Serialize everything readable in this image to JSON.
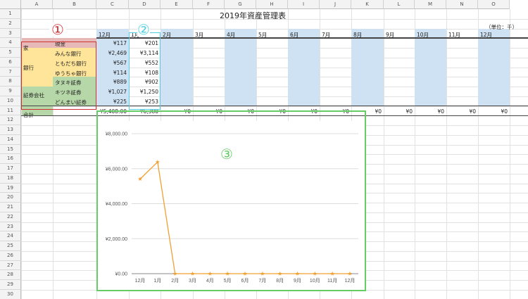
{
  "sheet": {
    "title": "2019年資産管理表",
    "unit_note": "（単位：千）",
    "column_headers": [
      "A",
      "B",
      "C",
      "D",
      "E",
      "F",
      "G",
      "H",
      "I",
      "J",
      "K",
      "L",
      "M",
      "N",
      "O"
    ],
    "row_numbers": [
      "1",
      "2",
      "3",
      "4",
      "5",
      "6",
      "7",
      "8",
      "9",
      "10",
      "11",
      "12",
      "13",
      "14",
      "15",
      "16",
      "17",
      "18",
      "19",
      "20",
      "21",
      "22",
      "23",
      "24",
      "25",
      "26",
      "27",
      "28",
      "29",
      "30"
    ],
    "month_headers": [
      "12月",
      "1月",
      "2月",
      "3月",
      "4月",
      "5月",
      "6月",
      "7月",
      "8月",
      "9月",
      "10月",
      "11月",
      "12月"
    ],
    "categories": [
      {
        "label": "家",
        "color": "#e6b8b8"
      },
      {
        "label": "銀行",
        "color": "#ffe599"
      },
      {
        "label": "証券会社",
        "color": "#b6d7a8"
      }
    ],
    "accounts": [
      {
        "name": "現金",
        "dec": "¥117",
        "jan": "¥201"
      },
      {
        "name": "みんな銀行",
        "dec": "¥2,469",
        "jan": "¥3,114"
      },
      {
        "name": "ともだち銀行",
        "dec": "¥567",
        "jan": "¥552"
      },
      {
        "name": "ゆうちゃ銀行",
        "dec": "¥114",
        "jan": "¥108"
      },
      {
        "name": "タヌキ証券",
        "dec": "¥889",
        "jan": "¥902"
      },
      {
        "name": "キツネ証券",
        "dec": "¥1,027",
        "jan": "¥1,250"
      },
      {
        "name": "どんまい証券",
        "dec": "¥225",
        "jan": "¥253"
      }
    ],
    "total_label": "合計",
    "totals": [
      "¥5,408.00",
      "¥6,380",
      "¥0",
      "¥0",
      "¥0",
      "¥0",
      "¥0",
      "¥0",
      "¥0",
      "¥0",
      "¥0",
      "¥0",
      "¥0"
    ],
    "annotations": [
      {
        "mark": "①",
        "color": "#d03030"
      },
      {
        "mark": "②",
        "color": "#4dd0e1"
      },
      {
        "mark": "③",
        "color": "#66cc66"
      }
    ],
    "colors": {
      "month_band": "#cfe2f3",
      "chart_line": "#f0a030",
      "grid": "#dddddd"
    }
  },
  "chart_data": {
    "type": "line",
    "categories": [
      "12月",
      "1月",
      "2月",
      "3月",
      "4月",
      "5月",
      "6月",
      "7月",
      "8月",
      "9月",
      "10月",
      "11月",
      "12月"
    ],
    "series": [
      {
        "values": [
          5408,
          6380,
          0,
          0,
          0,
          0,
          0,
          0,
          0,
          0,
          0,
          0,
          0
        ]
      }
    ],
    "ylim": [
      0,
      8000
    ],
    "yticks": [
      "¥0.00",
      "¥2,000.00",
      "¥4,000.00",
      "¥6,000.00",
      "¥8,000.00"
    ],
    "ytick_values": [
      0,
      2000,
      4000,
      6000,
      8000
    ],
    "grid": true,
    "legend": "none",
    "title": "",
    "xlabel": "",
    "ylabel": ""
  }
}
